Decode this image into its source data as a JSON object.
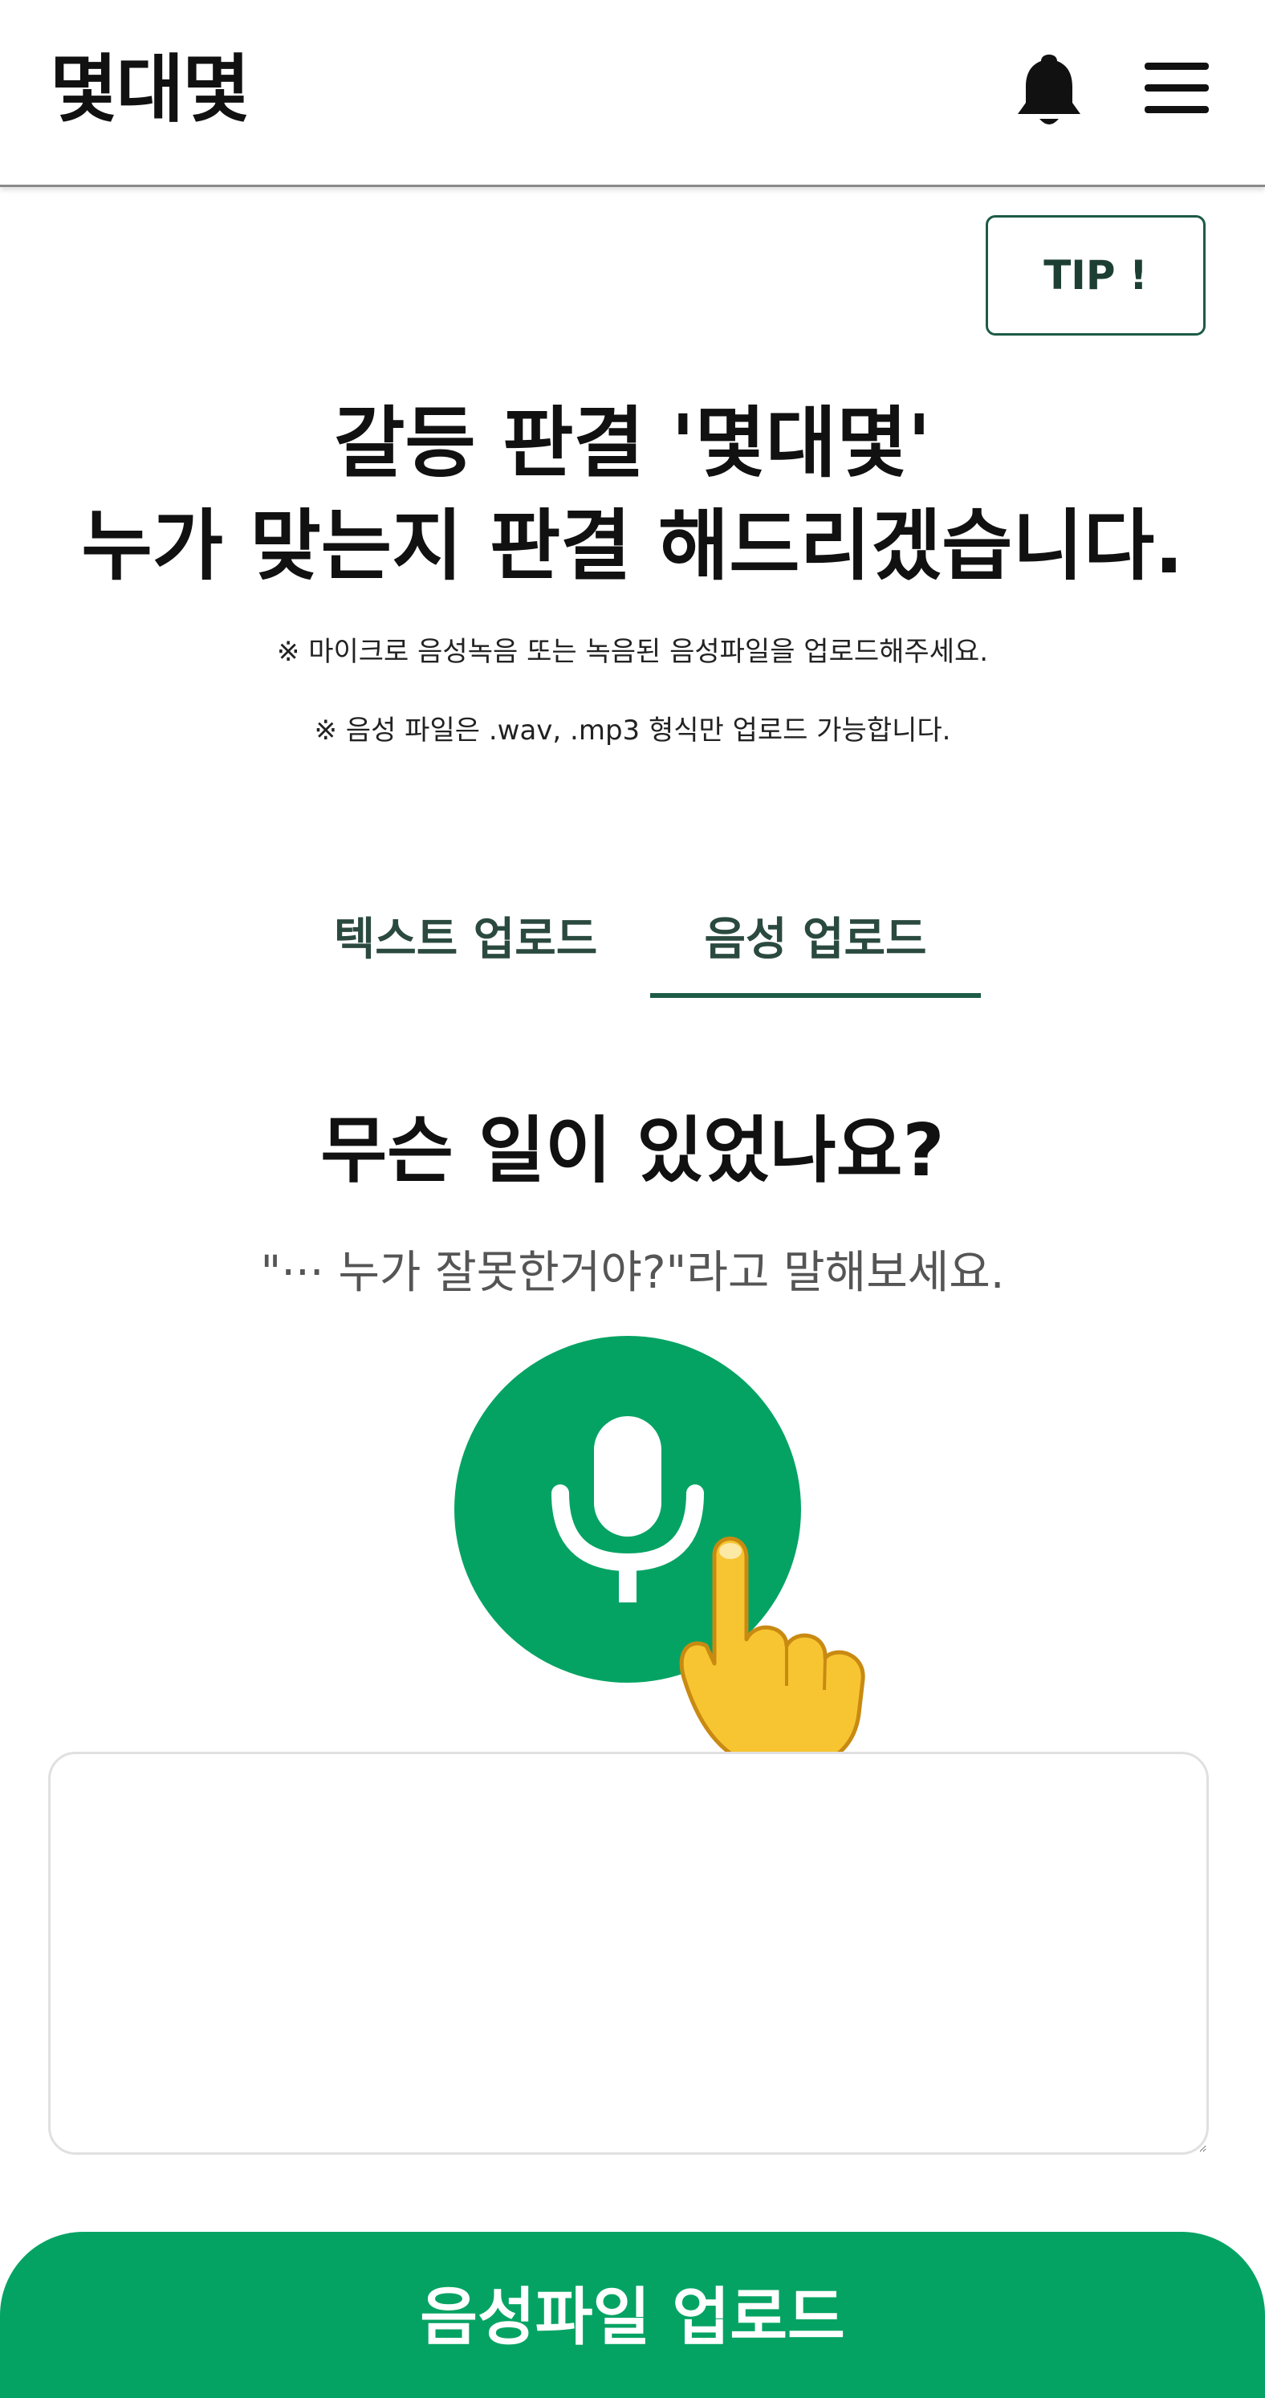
{
  "header": {
    "logo": "몇대몇",
    "bell_icon": "bell-icon",
    "menu_icon": "hamburger-menu-icon"
  },
  "tip_button": {
    "label": "TIP !"
  },
  "hero": {
    "title_line1": "갈등 판결 '몇대몇'",
    "title_line2": "누가 맞는지 판결 해드리겠습니다.",
    "notice1": "※ 마이크로 음성녹음 또는 녹음된 음성파일을 업로드해주세요.",
    "notice2": "※ 음성 파일은 .wav, .mp3 형식만 업로드 가능합니다."
  },
  "tabs": [
    {
      "label": "텍스트 업로드",
      "active": false
    },
    {
      "label": "음성 업로드",
      "active": true
    }
  ],
  "record": {
    "question": "무슨 일이 있었나요?",
    "hint": "\"··· 누가 잘못한거야?\"라고 말해보세요.",
    "mic_icon": "microphone-icon",
    "pointer_icon": "pointing-hand-icon"
  },
  "transcript": {
    "value": ""
  },
  "upload_button": {
    "label": "음성파일 업로드"
  },
  "colors": {
    "primary_green": "#05a363",
    "dark_green": "#1d5b46"
  }
}
